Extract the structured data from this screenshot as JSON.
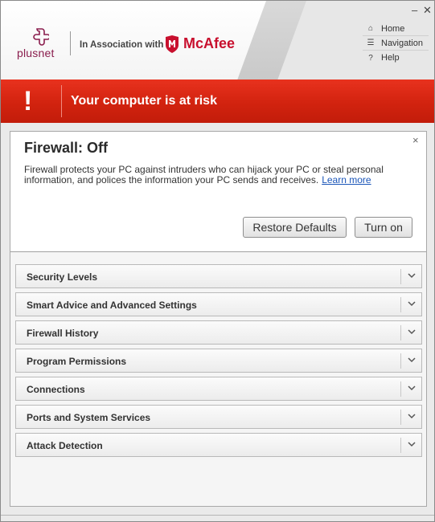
{
  "window_controls": {
    "minimize": "–",
    "close": "✕"
  },
  "header": {
    "brand": "plusnet",
    "association_text": "In Association with",
    "partner": "McAfee",
    "nav": [
      {
        "icon": "home-icon",
        "glyph": "⌂",
        "label": "Home"
      },
      {
        "icon": "list-icon",
        "glyph": "☰",
        "label": "Navigation"
      },
      {
        "icon": "help-icon",
        "glyph": "?",
        "label": "Help"
      }
    ]
  },
  "alert": {
    "glyph": "!",
    "message": "Your computer is at risk",
    "color": "#d2230f"
  },
  "firewall": {
    "title": "Firewall: Off",
    "description": "Firewall protects your PC against intruders who can hijack your PC or steal personal information, and polices the information your PC sends and receives.",
    "learn_more": "Learn more",
    "close_glyph": "×",
    "restore_label": "Restore Defaults",
    "turn_on_label": "Turn on"
  },
  "sections": [
    {
      "label": "Security Levels"
    },
    {
      "label": "Smart Advice and Advanced Settings"
    },
    {
      "label": "Firewall History"
    },
    {
      "label": "Program Permissions"
    },
    {
      "label": "Connections"
    },
    {
      "label": "Ports and System Services"
    },
    {
      "label": "Attack Detection"
    }
  ]
}
